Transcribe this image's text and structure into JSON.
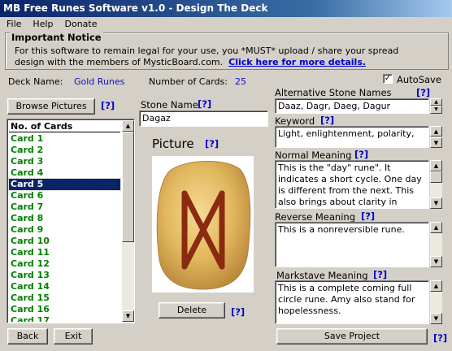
{
  "window": {
    "title": "MB Free Runes Software v1.0 - Design The Deck"
  },
  "menu": [
    "File",
    "Help",
    "Donate"
  ],
  "notice": {
    "title": "Important Notice",
    "line1": "For this software to remain legal for your use, you *MUST* upload / share your spread",
    "line2": "design with the members of MysticBoard.com.",
    "link": "Click here for more details."
  },
  "deck": {
    "name_label": "Deck Name:",
    "name": "Gold Runes",
    "count_label": "Number of Cards:",
    "count": "25"
  },
  "autosave": {
    "label": "AutoSave",
    "checked": true,
    "mark": "✓"
  },
  "help_label": "[?]",
  "buttons": {
    "browse": "Browse Pictures",
    "delete": "Delete",
    "back": "Back",
    "exit": "Exit",
    "save": "Save Project"
  },
  "card_list": {
    "header": "No. of Cards",
    "items": [
      "Card 1",
      "Card 2",
      "Card 3",
      "Card 4",
      "Card 5",
      "Card 6",
      "Card 7",
      "Card 8",
      "Card 9",
      "Card 10",
      "Card 11",
      "Card 12",
      "Card 13",
      "Card 14",
      "Card 15",
      "Card 16",
      "Card 17"
    ],
    "selected_index": 4
  },
  "stone": {
    "name_label": "Stone Name",
    "name_value": "Dagaz",
    "picture_label": "Picture"
  },
  "fields": {
    "alt_names_label": "Alternative Stone Names",
    "alt_names_value": "Daaz, Dagr, Daeg, Dagur",
    "keyword_label": "Keyword",
    "keyword_value": "Light, enlightenment, polarity,",
    "normal_label": "Normal Meaning",
    "normal_value": "This is the \"day\" rune\". It indicates a short cycle. One day is different from the next. This also brings about clarity in",
    "reverse_label": "Reverse Meaning",
    "reverse_value": "This is a nonreversible rune.",
    "markstave_label": "Markstave Meaning",
    "markstave_value": "This is a complete coming full circle rune. Amy also stand for hopelessness."
  },
  "colors": {
    "title_start": "#0a246a",
    "card_text": "#008000",
    "help": "#0000cc",
    "rune_stone": "#e2b85f",
    "rune_glyph": "#8a2a10"
  },
  "scroll_arrows": {
    "up": "▲",
    "down": "▼"
  }
}
